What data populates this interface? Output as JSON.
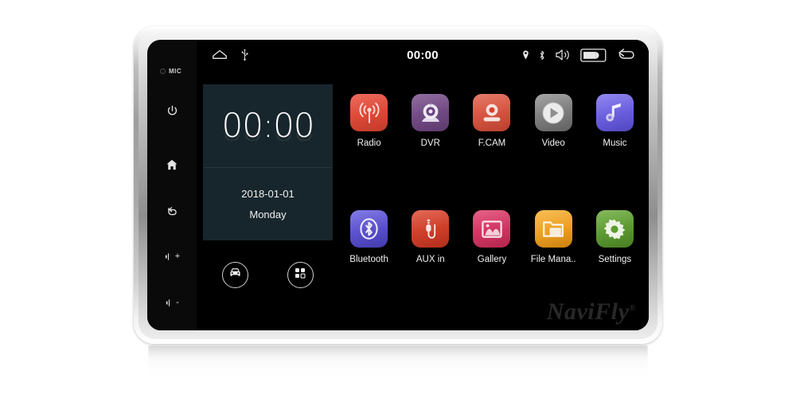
{
  "device": {
    "brand_watermark": "NaviFly",
    "brand_mark": "®",
    "mic_label": "MIC"
  },
  "hardware_keys": [
    {
      "name": "power-key",
      "icon": "power-icon"
    },
    {
      "name": "home-key",
      "icon": "home-icon"
    },
    {
      "name": "back-key",
      "icon": "back-arrow-icon"
    },
    {
      "name": "volume-up-key",
      "icon": "volume-icon",
      "sign": "+"
    },
    {
      "name": "volume-down-key",
      "icon": "volume-icon",
      "sign": "-"
    }
  ],
  "status_bar": {
    "left_icons": [
      "home-outline-icon",
      "usb-icon"
    ],
    "clock": "00:00",
    "right_icons": [
      "location-pin-icon",
      "bluetooth-icon",
      "volume-speaker-icon",
      "battery-icon",
      "back-arrow-icon"
    ]
  },
  "clock_widget": {
    "time": "00:00",
    "date": "2018-01-01",
    "weekday": "Monday",
    "background_color": "#17262c"
  },
  "shortcuts": [
    {
      "name": "car-shortcut-button",
      "icon": "car-icon"
    },
    {
      "name": "all-apps-button",
      "icon": "apps-grid-icon"
    }
  ],
  "apps": [
    {
      "label": "Radio",
      "icon": "radio-signal-icon",
      "color": "#e8503f",
      "color2": "#d6412f"
    },
    {
      "label": "DVR",
      "icon": "webcam-icon",
      "color": "#7d5490",
      "color2": "#6a4279"
    },
    {
      "label": "F.CAM",
      "icon": "front-camera-icon",
      "color": "#e0634f",
      "color2": "#cf4a36"
    },
    {
      "label": "Video",
      "icon": "play-circle-icon",
      "color": "#8a8a8a",
      "color2": "#6e6e6e"
    },
    {
      "label": "Music",
      "icon": "music-note-icon",
      "color": "#7468e8",
      "color2": "#5b4fd6"
    },
    {
      "label": "Bluetooth",
      "icon": "bluetooth-icon",
      "color": "#6359da",
      "color2": "#4f45c4"
    },
    {
      "label": "AUX in",
      "icon": "aux-plug-icon",
      "color": "#d8432e",
      "color2": "#c2341f"
    },
    {
      "label": "Gallery",
      "icon": "photo-icon",
      "color": "#d93c68",
      "color2": "#c52a56"
    },
    {
      "label": "File Mana..",
      "icon": "folder-icon",
      "color": "#f2a627",
      "color2": "#e0920f"
    },
    {
      "label": "Settings",
      "icon": "gear-icon",
      "color": "#63a138",
      "color2": "#508a28"
    }
  ]
}
